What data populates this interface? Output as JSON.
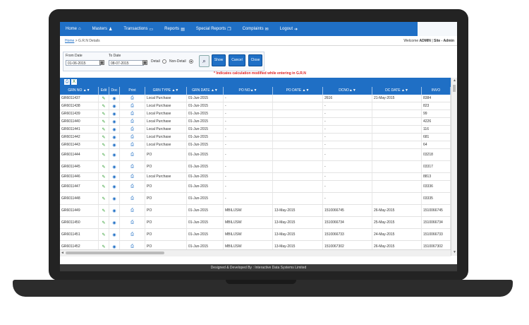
{
  "nav": {
    "items": [
      {
        "label": "Home",
        "icon": "home-icon",
        "glyph": "⌂"
      },
      {
        "label": "Masters",
        "icon": "user-icon",
        "glyph": "♟"
      },
      {
        "label": "Transactions",
        "icon": "card-icon",
        "glyph": "▭"
      },
      {
        "label": "Reports",
        "icon": "document-icon",
        "glyph": "▤"
      },
      {
        "label": "Special Reports",
        "icon": "copy-icon",
        "glyph": "❐"
      },
      {
        "label": "Complaints",
        "icon": "mail-icon",
        "glyph": "✉"
      },
      {
        "label": "Logout",
        "icon": "logout-icon",
        "glyph": "➔"
      }
    ]
  },
  "breadcrumb": {
    "home": "Home",
    "separator": ">",
    "current": "G.R.N Details"
  },
  "welcome": {
    "prefix": "Welcome",
    "user": "ADMIN",
    "site": "Site - Admin"
  },
  "filter": {
    "from_label": "From Date",
    "from_value": "01-06-2015",
    "to_label": "To Date",
    "to_value": "08-07-2015",
    "detail_label": "Detail",
    "non_detail_label": "Non-Detail",
    "selected": "Non-Detail",
    "show_label": "Show",
    "cancel_label": "Cancel",
    "close_label": "Close"
  },
  "note": "* Indicates calculation modified while entering in G.R.N",
  "table": {
    "columns": [
      "GRN NO ▲▼",
      "Edit",
      "Doc",
      "Print",
      "GRN TYPE ▲▼",
      "GRN DATE ▲▼",
      "PO NO▲▼",
      "PO DATE ▲▼",
      "DCNO▲▼",
      "DC DATE ▲▼",
      "INVO"
    ],
    "rows": [
      {
        "grn": "GR6011437",
        "type": "Local Purchase",
        "date": "01-Jun-2015",
        "po": "-",
        "podate": "",
        "dc": "2616",
        "dcdate": "21-May-2015",
        "inv": "8384"
      },
      {
        "grn": "GR6011438",
        "type": "Local Purchase",
        "date": "01-Jun-2015",
        "po": "-",
        "podate": "",
        "dc": "-",
        "dcdate": "",
        "inv": "823"
      },
      {
        "grn": "GR6011439",
        "type": "Local Purchase",
        "date": "01-Jun-2015",
        "po": "-",
        "podate": "",
        "dc": "-",
        "dcdate": "",
        "inv": "99"
      },
      {
        "grn": "GR6011440",
        "type": "Local Purchase",
        "date": "01-Jun-2015",
        "po": "-",
        "podate": "",
        "dc": "-",
        "dcdate": "",
        "inv": "4226"
      },
      {
        "grn": "GR6011441",
        "type": "Local Purchase",
        "date": "01-Jun-2015",
        "po": "-",
        "podate": "",
        "dc": "-",
        "dcdate": "",
        "inv": "116"
      },
      {
        "grn": "GR6011442",
        "type": "Local Purchase",
        "date": "01-Jun-2015",
        "po": "-",
        "podate": "",
        "dc": "-",
        "dcdate": "",
        "inv": "681"
      },
      {
        "grn": "GR6011443",
        "type": "Local Purchase",
        "date": "01-Jun-2015",
        "po": "-",
        "podate": "",
        "dc": "-",
        "dcdate": "",
        "inv": "64"
      },
      {
        "grn": "GR6011444",
        "type": "PO",
        "date": "01-Jun-2015",
        "po": "-",
        "podate": "",
        "dc": "-",
        "dcdate": "",
        "inv": "03218"
      },
      {
        "grn": "GR6011445",
        "type": "PO",
        "date": "01-Jun-2015",
        "po": "-",
        "podate": "",
        "dc": "-",
        "dcdate": "",
        "inv": "03317"
      },
      {
        "grn": "GR6011446",
        "type": "Local Purchase",
        "date": "01-Jun-2015",
        "po": "-",
        "podate": "",
        "dc": "-",
        "dcdate": "",
        "inv": "8813"
      },
      {
        "grn": "GR6011447",
        "type": "PO",
        "date": "01-Jun-2015",
        "po": "-",
        "podate": "",
        "dc": "-",
        "dcdate": "",
        "inv": "03336"
      },
      {
        "grn": "GR6011448",
        "type": "PO",
        "date": "01-Jun-2015",
        "po": "-",
        "podate": "",
        "dc": "-",
        "dcdate": "",
        "inv": "03335"
      },
      {
        "grn": "GR6011449",
        "type": "PO",
        "date": "01-Jun-2015",
        "po": "MBIL/JSW",
        "podate": "13-May-2015",
        "dc": "1510066745",
        "dcdate": "26-May-2015",
        "inv": "1510066745"
      },
      {
        "grn": "GR6011450",
        "type": "PO",
        "date": "01-Jun-2015",
        "po": "MBIL/JSW",
        "podate": "13-May-2015",
        "dc": "1510066734",
        "dcdate": "25-May-2015",
        "inv": "1510066734"
      },
      {
        "grn": "GR6011451",
        "type": "PO",
        "date": "01-Jun-2015",
        "po": "MBIL/JSW",
        "podate": "13-May-2015",
        "dc": "1510066733",
        "dcdate": "24-May-2015",
        "inv": "1510066733"
      },
      {
        "grn": "GR6011452",
        "type": "PO",
        "date": "01-Jun-2015",
        "po": "MBIL/JSW",
        "podate": "13-May-2015",
        "dc": "1510067302",
        "dcdate": "26-May-2015",
        "inv": "1510067302"
      }
    ]
  },
  "footer": "Designed & Developed By : Interactive Data Systems Limited",
  "colors": {
    "primary": "#1f6fc5",
    "alert": "#e02020",
    "edit": "#2a9a2a"
  }
}
